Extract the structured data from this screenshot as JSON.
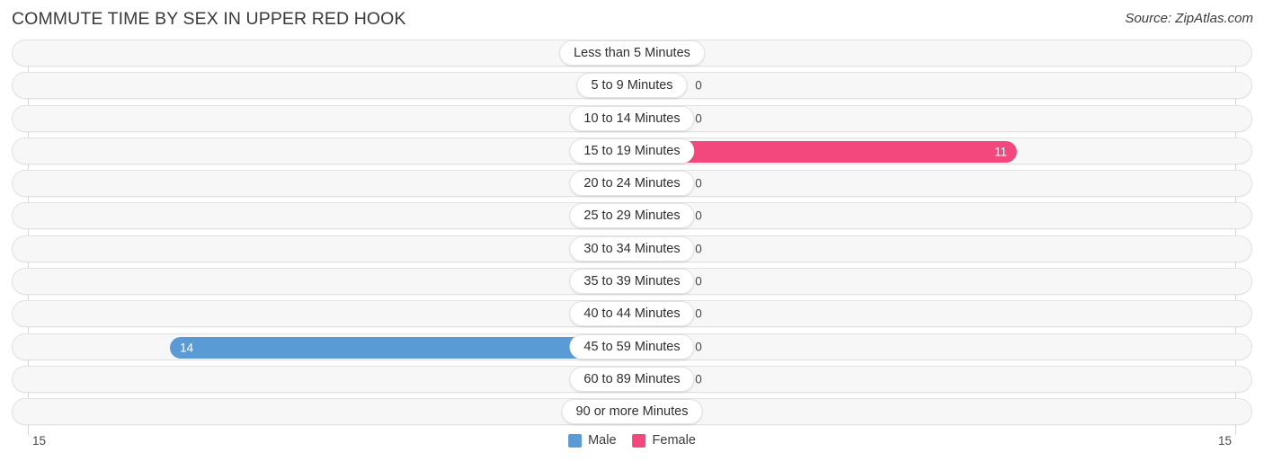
{
  "header": {
    "title": "COMMUTE TIME BY SEX IN UPPER RED HOOK",
    "source": "Source: ZipAtlas.com"
  },
  "axis": {
    "min_label": "15",
    "max_label": "15"
  },
  "legend": {
    "items": [
      {
        "label": "Male",
        "color": "#5b9bd5"
      },
      {
        "label": "Female",
        "color": "#f2487e"
      }
    ]
  },
  "colors": {
    "male_filled": "#5b9bd5",
    "male_empty": "#a8c8ea",
    "female_filled": "#f2487e",
    "female_empty": "#f5a3bf",
    "row_background": "#f7f7f7",
    "row_border": "#e2e2e2",
    "title": "#3b3b3b"
  },
  "chart_data": {
    "type": "bar",
    "orientation": "horizontal-diverging",
    "title": "COMMUTE TIME BY SEX IN UPPER RED HOOK",
    "xlabel": "",
    "ylabel": "",
    "xlim": [
      15,
      15
    ],
    "grid": true,
    "legend_position": "bottom-center",
    "categories": [
      "Less than 5 Minutes",
      "5 to 9 Minutes",
      "10 to 14 Minutes",
      "15 to 19 Minutes",
      "20 to 24 Minutes",
      "25 to 29 Minutes",
      "30 to 34 Minutes",
      "35 to 39 Minutes",
      "40 to 44 Minutes",
      "45 to 59 Minutes",
      "60 to 89 Minutes",
      "90 or more Minutes"
    ],
    "series": [
      {
        "name": "Male",
        "color": "#5b9bd5",
        "values": [
          0,
          0,
          0,
          0,
          0,
          0,
          0,
          0,
          0,
          14,
          0,
          0
        ]
      },
      {
        "name": "Female",
        "color": "#f2487e",
        "values": [
          0,
          0,
          0,
          11,
          0,
          0,
          0,
          0,
          0,
          0,
          0,
          0
        ]
      }
    ]
  }
}
